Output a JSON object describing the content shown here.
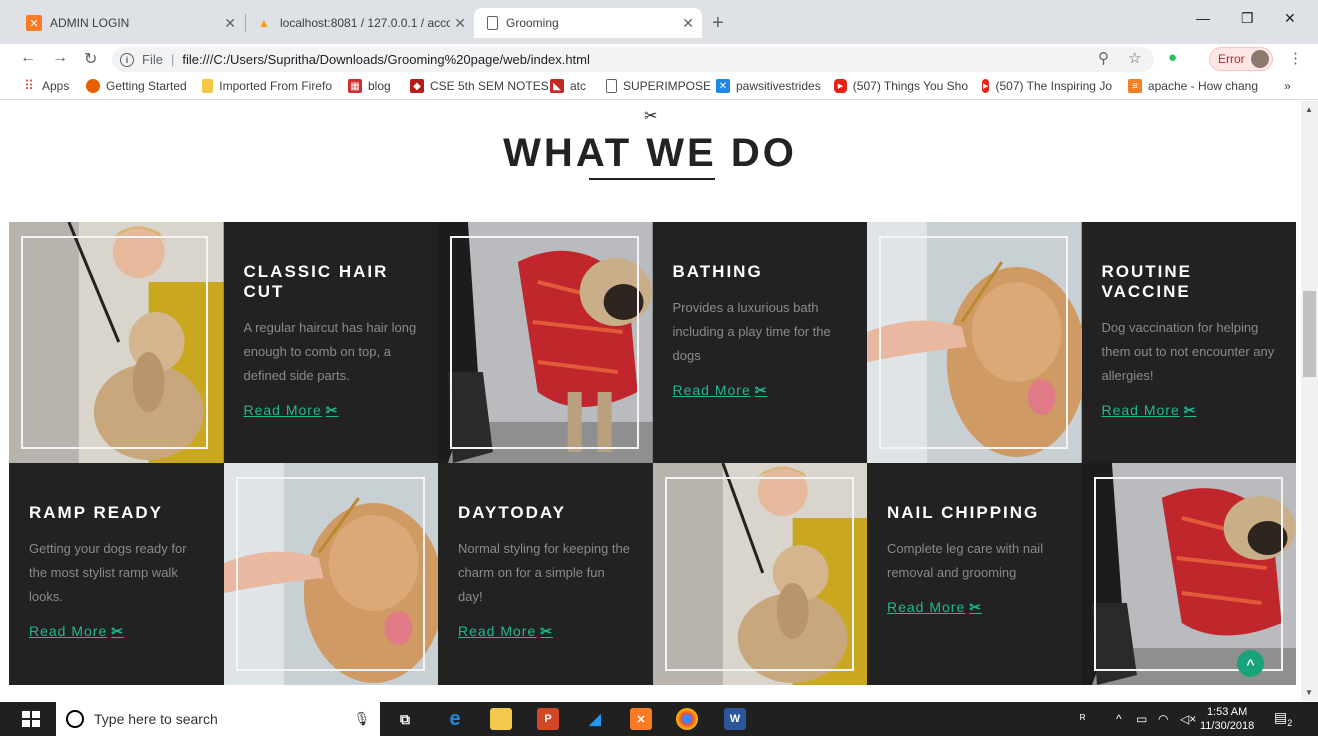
{
  "browser": {
    "tabs": [
      {
        "title": "ADMIN LOGIN",
        "icon": "xampp-icon",
        "color": "#fb7a24"
      },
      {
        "title": "localhost:8081 / 127.0.0.1 / acco",
        "icon": "phpmyadmin-icon",
        "color": "#f89c0e"
      },
      {
        "title": "Grooming",
        "icon": "file-icon",
        "color": "#5f6368"
      }
    ],
    "address": {
      "scheme": "File",
      "url": "file:///C:/Users/Supritha/Downloads/Grooming%20page/web/index.html"
    },
    "error_label": "Error",
    "bookmarks": [
      {
        "label": "Apps",
        "icon": "apps-grid-icon"
      },
      {
        "label": "Getting Started",
        "icon": "firefox-icon"
      },
      {
        "label": "Imported From Firefo",
        "icon": "folder-icon"
      },
      {
        "label": "blog",
        "icon": "blog-icon"
      },
      {
        "label": "CSE 5th SEM NOTES",
        "icon": "notes-icon"
      },
      {
        "label": "atc",
        "icon": "atc-icon"
      },
      {
        "label": "SUPERIMPOSE",
        "icon": "file-icon"
      },
      {
        "label": "pawsitivestrides",
        "icon": "paw-icon"
      },
      {
        "label": "(507) Things You Sho",
        "icon": "youtube-icon"
      },
      {
        "label": "(507) The Inspiring Jo",
        "icon": "youtube-icon"
      },
      {
        "label": "apache - How chang",
        "icon": "stackoverflow-icon"
      }
    ],
    "bookmarks_more": "»"
  },
  "page": {
    "scissor_glyph": "✂",
    "heading": "WHAT WE DO",
    "services": [
      {
        "title": "CLASSIC HAIR CUT",
        "desc": "A regular haircut has hair long enough to comb on top, a defined side parts.",
        "link": "Read More"
      },
      {
        "title": "BATHING",
        "desc": "Provides a luxurious bath including a play time for the dogs",
        "link": "Read More"
      },
      {
        "title": "ROUTINE VACCINE",
        "desc": "Dog vaccination for helping them out to not encounter any allergies!",
        "link": "Read More"
      },
      {
        "title": "RAMP READY",
        "desc": "Getting your dogs ready for the most stylist ramp walk looks.",
        "link": "Read More"
      },
      {
        "title": "DAYTODAY",
        "desc": "Normal styling for keeping the charm on for a simple fun day!",
        "link": "Read More"
      },
      {
        "title": "NAIL CHIPPING",
        "desc": "Complete leg care with nail removal and grooming",
        "link": "Read More"
      }
    ],
    "link_icon": "✂",
    "back_to_top": "^"
  },
  "taskbar": {
    "search_placeholder": "Type here to search",
    "time": "1:53 AM",
    "date": "11/30/2018",
    "notifications": "2"
  },
  "colors": {
    "accent": "#1db992",
    "dark_panel": "#222222"
  }
}
